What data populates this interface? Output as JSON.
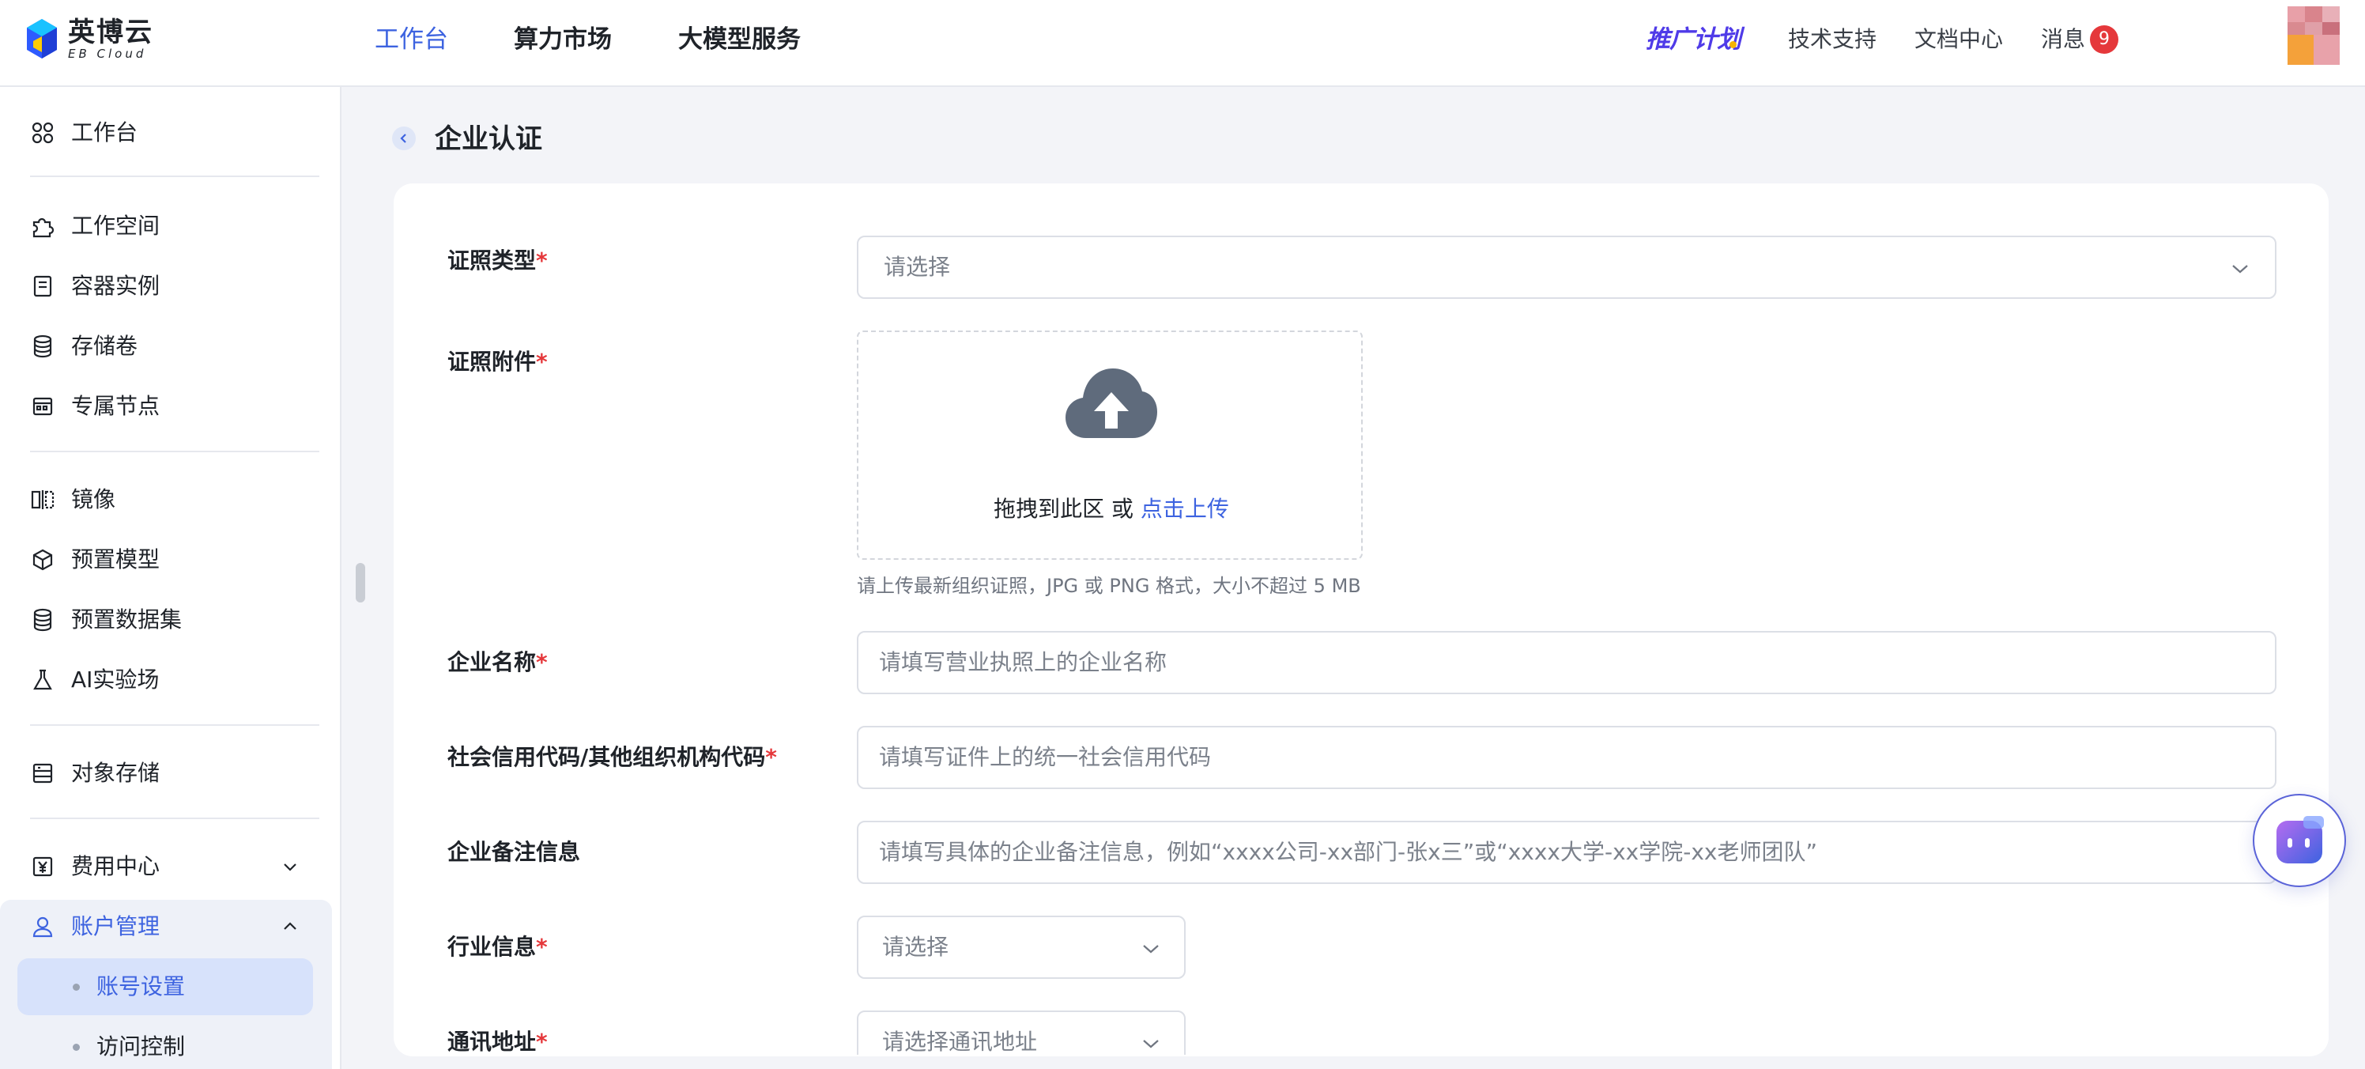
{
  "brand": {
    "name_cn": "英博云",
    "name_en": "EB Cloud"
  },
  "topnav": {
    "items": [
      {
        "label": "工作台",
        "active": true
      },
      {
        "label": "算力市场",
        "active": false
      },
      {
        "label": "大模型服务",
        "active": false
      }
    ],
    "promo": "推广计划",
    "links": {
      "support": "技术支持",
      "docs": "文档中心",
      "messages": "消息"
    },
    "message_count": "9"
  },
  "sidebar": {
    "items": [
      {
        "label": "工作台",
        "icon": "grid-icon"
      },
      {
        "label": "工作空间",
        "icon": "puzzle-icon"
      },
      {
        "label": "容器实例",
        "icon": "container-icon"
      },
      {
        "label": "存储卷",
        "icon": "database-icon"
      },
      {
        "label": "专属节点",
        "icon": "node-icon"
      },
      {
        "label": "镜像",
        "icon": "mirror-icon"
      },
      {
        "label": "预置模型",
        "icon": "cube-icon"
      },
      {
        "label": "预置数据集",
        "icon": "dataset-icon"
      },
      {
        "label": "AI实验场",
        "icon": "flask-icon"
      },
      {
        "label": "对象存储",
        "icon": "object-storage-icon"
      },
      {
        "label": "费用中心",
        "icon": "yen-icon",
        "expanded": false
      },
      {
        "label": "账户管理",
        "icon": "user-icon",
        "expanded": true
      }
    ],
    "account_sub": [
      {
        "label": "账号设置",
        "active": true
      },
      {
        "label": "访问控制",
        "active": false
      }
    ]
  },
  "page": {
    "title": "企业认证"
  },
  "form": {
    "cert_type": {
      "label": "证照类型",
      "required": "*",
      "placeholder": "请选择"
    },
    "cert_attachment": {
      "label": "证照附件",
      "required": "*",
      "drag_text": "拖拽到此区 或 ",
      "click_text": "点击上传",
      "hint": "请上传最新组织证照，JPG 或 PNG 格式，大小不超过 5 MB"
    },
    "company_name": {
      "label": "企业名称",
      "required": "*",
      "placeholder": "请填写营业执照上的企业名称"
    },
    "credit_code": {
      "label": "社会信用代码/其他组织机构代码",
      "required": "*",
      "placeholder": "请填写证件上的统一社会信用代码"
    },
    "remark": {
      "label": "企业备注信息",
      "placeholder": "请填写具体的企业备注信息，例如“xxxx公司-xx部门-张x三”或“xxxx大学-xx学院-xx老师团队”"
    },
    "industry": {
      "label": "行业信息",
      "required": "*",
      "placeholder": "请选择"
    },
    "address": {
      "label": "通讯地址",
      "required": "*",
      "placeholder": "请选择通讯地址"
    }
  },
  "colors": {
    "primary": "#3d63e0",
    "required": "#e5383b",
    "badge": "#e5383b",
    "promo": "#4f3be8"
  }
}
